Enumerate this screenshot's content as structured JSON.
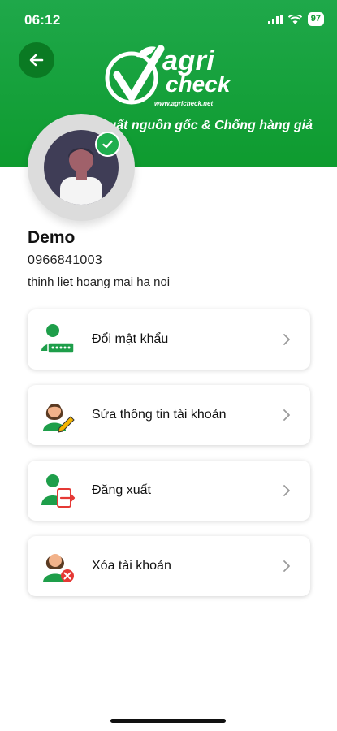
{
  "status_bar": {
    "time": "06:12",
    "battery": "97"
  },
  "header": {
    "logo": {
      "agri": "agri",
      "check": "check",
      "url": "www.agricheck.net"
    },
    "tagline": "Truy xuất nguồn gốc & Chống hàng giả"
  },
  "profile": {
    "name": "Demo",
    "phone": "0966841003",
    "address": "thinh liet hoang mai ha noi"
  },
  "menu": {
    "items": [
      {
        "label": "Đổi mật khẩu",
        "icon": "user-password-icon"
      },
      {
        "label": "Sửa thông tin tài khoản",
        "icon": "user-edit-icon"
      },
      {
        "label": "Đăng xuất",
        "icon": "user-logout-icon"
      },
      {
        "label": "Xóa tài khoản",
        "icon": "user-delete-icon"
      }
    ]
  },
  "colors": {
    "brand_green": "#0e9b2f",
    "accent_red": "#e53935"
  }
}
